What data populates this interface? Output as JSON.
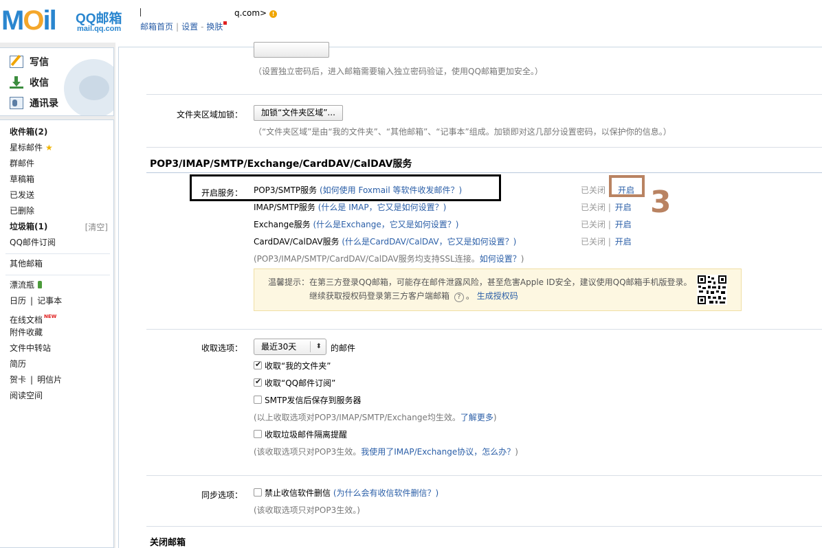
{
  "header": {
    "logo_word_m": "M",
    "logo_word_o": "O",
    "logo_word_il": "il",
    "logo_qq": "QQ邮箱",
    "logo_url": "mail.qq.com",
    "email_suffix": "q.com>",
    "top_links": [
      "邮箱首页",
      "设置",
      "换肤"
    ],
    "separators": [
      "|",
      "-"
    ]
  },
  "sidebar": {
    "quick_actions": [
      {
        "label": "写信",
        "icon": "compose-icon"
      },
      {
        "label": "收信",
        "icon": "inbox-download-icon"
      },
      {
        "label": "通讯录",
        "icon": "contacts-icon"
      }
    ],
    "folders": [
      {
        "label": "收件箱(2)"
      },
      {
        "label": "星标邮件"
      },
      {
        "label": "群邮件"
      },
      {
        "label": "草稿箱"
      },
      {
        "label": "已发送"
      },
      {
        "label": "已删除"
      },
      {
        "label": "垃圾箱(1)",
        "action": "[清空]"
      },
      {
        "label": "QQ邮件订阅"
      }
    ],
    "other_mailbox": "其他邮箱",
    "tools": [
      {
        "label": "漂流瓶"
      },
      {
        "label": "日历",
        "second": "记事本"
      },
      {
        "label": "在线文档",
        "badge": "NEW"
      },
      {
        "label": "附件收藏"
      },
      {
        "label": "文件中转站"
      },
      {
        "label": "简历"
      },
      {
        "label": "贺卡",
        "second": "明信片"
      },
      {
        "label": "阅读空间"
      }
    ],
    "pipe": "|"
  },
  "main": {
    "top_note": "（设置独立密码后，进入邮箱需要输入独立密码验证，使用QQ邮箱更加安全。）",
    "folder_lock_label": "文件夹区域加锁：",
    "folder_lock_button": "加锁“文件夹区域”...",
    "folder_lock_note": "（“文件夹区域”是由“我的文件夹”、“其他邮箱”、“记事本”组成。加锁即对这几部分设置密码，以保护你的信息。）",
    "services_title": "POP3/IMAP/SMTP/Exchange/CardDAV/CalDAV服务",
    "enable_services_label": "开启服务：",
    "services": [
      {
        "name": "POP3/SMTP服务",
        "help": "(如何使用 Foxmail 等软件收发邮件？)",
        "status": "已关闭",
        "action": "开启"
      },
      {
        "name": "IMAP/SMTP服务",
        "help": "(什么是 IMAP，它又是如何设置？)",
        "status": "已关闭",
        "action": "开启"
      },
      {
        "name": "Exchange服务",
        "help": "(什么是Exchange，它又是如何设置？)",
        "status": "已关闭",
        "action": "开启"
      },
      {
        "name": "CardDAV/CalDAV服务",
        "help": "(什么是CardDAV/CalDAV，它又是如何设置？)",
        "status": "已关闭",
        "action": "开启"
      }
    ],
    "status_sep": "|",
    "ssl_note_pre": "(POP3/IMAP/SMTP/CardDAV/CalDAV服务均支持SSL连接。",
    "ssl_note_link": "如何设置？",
    "ssl_note_post": ")",
    "tip": {
      "line1": "温馨提示：在第三方登录QQ邮箱，可能存在邮件泄露风险，甚至危害Apple ID安全，建议使用QQ邮箱手机版登录。",
      "line2": "继续获取授权码登录第三方客户端邮箱",
      "help_icon": "?",
      "period": "。",
      "link": "生成授权码"
    },
    "receive_label": "收取选项：",
    "receive_select": "最近30天",
    "receive_suffix": "的邮件",
    "receive_options": [
      {
        "label": "收取“我的文件夹”",
        "checked": true
      },
      {
        "label": "收取“QQ邮件订阅”",
        "checked": true
      },
      {
        "label": "SMTP发信后保存到服务器",
        "checked": false
      }
    ],
    "receive_note_pre": "(以上收取选项对POP3/IMAP/SMTP/Exchange均生效。",
    "receive_note_link": "了解更多",
    "receive_note_post": ")",
    "spam_option": {
      "label": "收取垃圾邮件隔离提醒",
      "checked": false
    },
    "spam_note_pre": "(该收取选项只对POP3生效。",
    "spam_note_link": "我使用了IMAP/Exchange协议，怎么办？",
    "spam_note_post": ")",
    "sync_label": "同步选项：",
    "sync_option": {
      "label": "禁止收信软件删信",
      "checked": false
    },
    "sync_help": "(为什么会有收信软件删信？)",
    "sync_note": "(该收取选项只对POP3生效。)",
    "close_mailbox_title": "关闭邮箱"
  },
  "annotation": {
    "step_number": "3",
    "color_box": "#b98362",
    "color_box_black": "#000000"
  },
  "colors": {
    "link": "#2a5ea7",
    "logo_blue": "#2a86cf",
    "logo_orange": "#f4a72b",
    "tip_bg": "#fdf7e1"
  }
}
